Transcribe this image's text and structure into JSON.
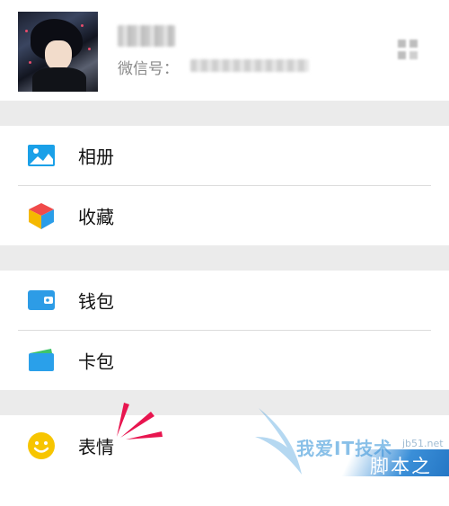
{
  "profile": {
    "wechat_id_label": "微信号："
  },
  "menu": {
    "album": "相册",
    "favorites": "收藏",
    "wallet": "钱包",
    "card_pack": "卡包",
    "stickers": "表情"
  },
  "watermark": {
    "text1": "我爱IT技术",
    "url": "jb51.net",
    "text2": "脚本之家"
  },
  "colors": {
    "album_icon": "#1aa0e8",
    "wallet_icon": "#2d9ce6",
    "card_pack_icon": "#2aa0ea",
    "stickers_icon": "#f7c500",
    "annotation_marks": "#e8154f",
    "section_gap": "#ebebeb"
  }
}
